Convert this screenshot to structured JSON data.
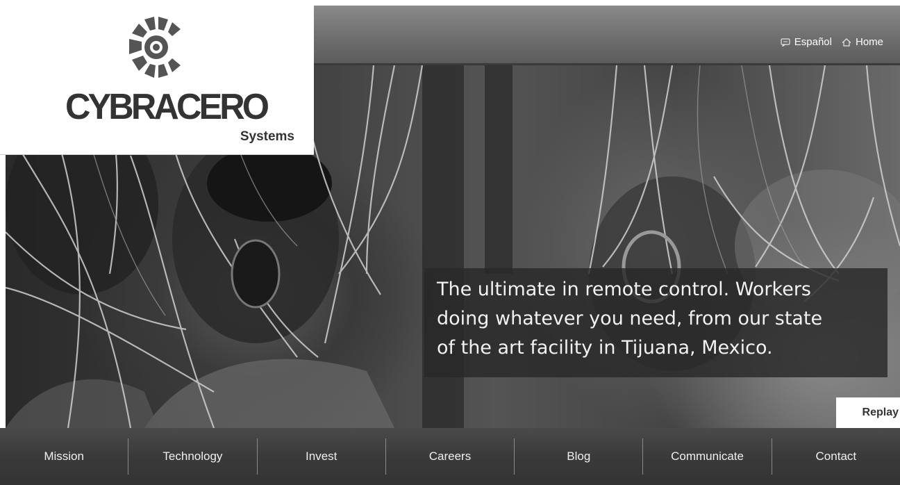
{
  "brand": {
    "name": "CYBRACERO",
    "subtitle": "Systems"
  },
  "header": {
    "links": [
      {
        "label": "Español",
        "icon": "chat-icon"
      },
      {
        "label": "Home",
        "icon": "home-icon"
      }
    ]
  },
  "hero": {
    "caption_lines": [
      "The ultimate in remote control. Workers",
      "doing whatever you need, from our state",
      "of the art facility in Tijuana, Mexico."
    ],
    "replay_label": "Replay"
  },
  "nav": {
    "items": [
      {
        "label": "Mission"
      },
      {
        "label": "Technology"
      },
      {
        "label": "Invest"
      },
      {
        "label": "Careers"
      },
      {
        "label": "Blog"
      },
      {
        "label": "Communicate"
      },
      {
        "label": "Contact"
      }
    ]
  },
  "colors": {
    "logo_gray": "#555555",
    "nav_bg": "#3a3a3a",
    "caption_bg": "#282828"
  }
}
